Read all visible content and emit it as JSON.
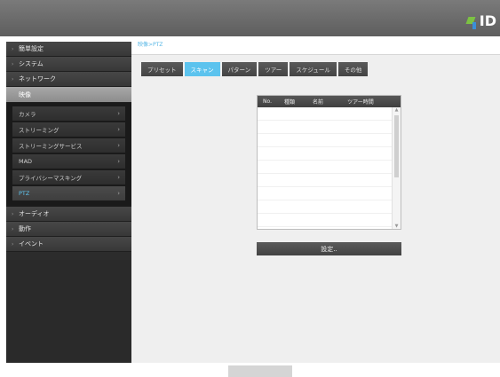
{
  "header": {
    "logo_text": "ID",
    "brand_colors": [
      "#7cc243",
      "#3a8fd8"
    ]
  },
  "sidebar": {
    "items": [
      {
        "label": "簡単設定"
      },
      {
        "label": "システム"
      },
      {
        "label": "ネットワーク"
      },
      {
        "label": "映像",
        "active": true
      },
      {
        "label": "オーディオ"
      },
      {
        "label": "動作"
      },
      {
        "label": "イベント"
      }
    ],
    "submenu": [
      {
        "label": "カメラ"
      },
      {
        "label": "ストリーミング"
      },
      {
        "label": "ストリーミングサービス"
      },
      {
        "label": "MAD"
      },
      {
        "label": "プライバシーマスキング"
      },
      {
        "label": "PTZ",
        "selected": true
      }
    ]
  },
  "breadcrumb": "映像>PTZ",
  "tabs": [
    {
      "label": "プリセット"
    },
    {
      "label": "スキャン",
      "active": true
    },
    {
      "label": "パターン"
    },
    {
      "label": "ツアー"
    },
    {
      "label": "スケジュール"
    },
    {
      "label": "その他"
    }
  ],
  "table": {
    "columns": [
      "No.",
      "種類",
      "名前",
      "ツアー時間"
    ]
  },
  "set_button_label": "設定..",
  "accent_color": "#5cc3ee"
}
